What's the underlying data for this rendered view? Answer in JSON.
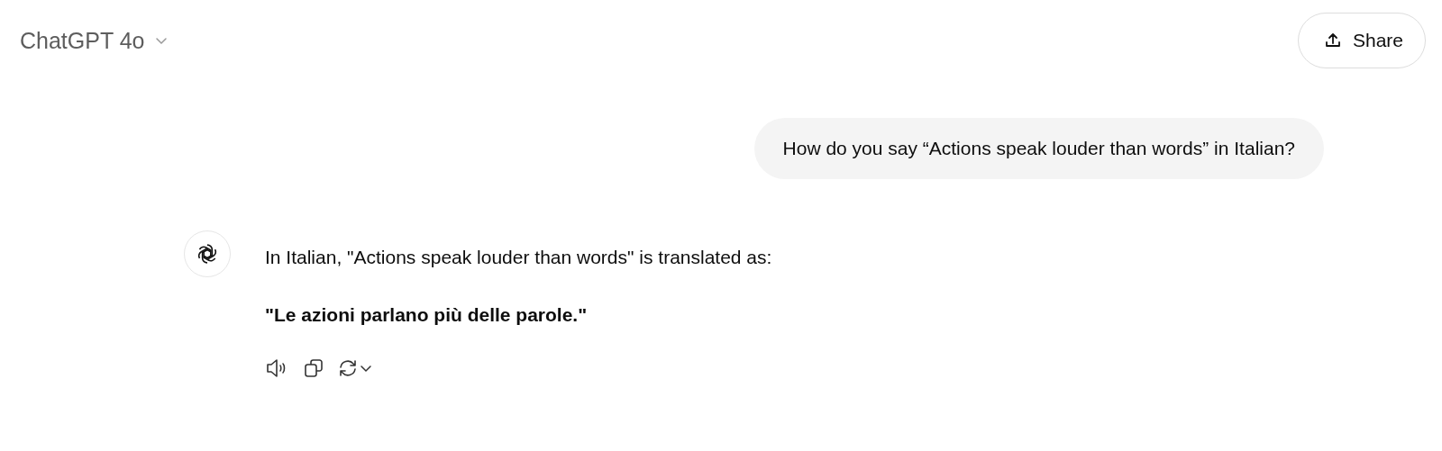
{
  "header": {
    "model": "ChatGPT 4o",
    "share_label": "Share"
  },
  "user_message": {
    "text": "How do you say “Actions speak louder than words” in Italian?"
  },
  "assistant_message": {
    "paragraphs": [
      "In Italian, \"Actions speak louder than words\" is translated as:",
      "**\"Le azioni parlano più delle parole.\"**"
    ]
  }
}
